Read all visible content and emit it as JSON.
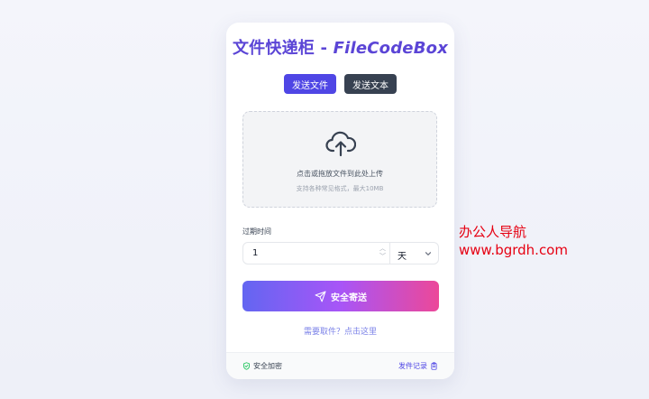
{
  "app": {
    "title_cn": "文件快递柜",
    "title_dash": " - ",
    "title_en": "FileCodeBox"
  },
  "tabs": [
    {
      "label": "发送文件",
      "active": true
    },
    {
      "label": "发送文本",
      "active": false
    }
  ],
  "upload": {
    "icon": "cloud-upload-icon",
    "main_text": "点击或拖放文件到此处上传",
    "sub_text": "支持各种常见格式，最大10MB"
  },
  "expiry": {
    "label": "过期时间",
    "value": "1",
    "unit": "天"
  },
  "send_button": {
    "label": "安全寄送",
    "icon": "send-icon"
  },
  "retrieve_link": "需要取件？点击这里",
  "footer": {
    "secure_label": "安全加密",
    "history_label": "发件记录"
  },
  "watermark": {
    "line1": "办公人导航",
    "line2": "www.bgrdh.com"
  },
  "colors": {
    "accent": "#5b45d6",
    "tab_active": "#4f46e5",
    "tab_inactive": "#374151",
    "gradient_start": "#6366f1",
    "gradient_end": "#ec4899",
    "watermark": "#e60012"
  }
}
